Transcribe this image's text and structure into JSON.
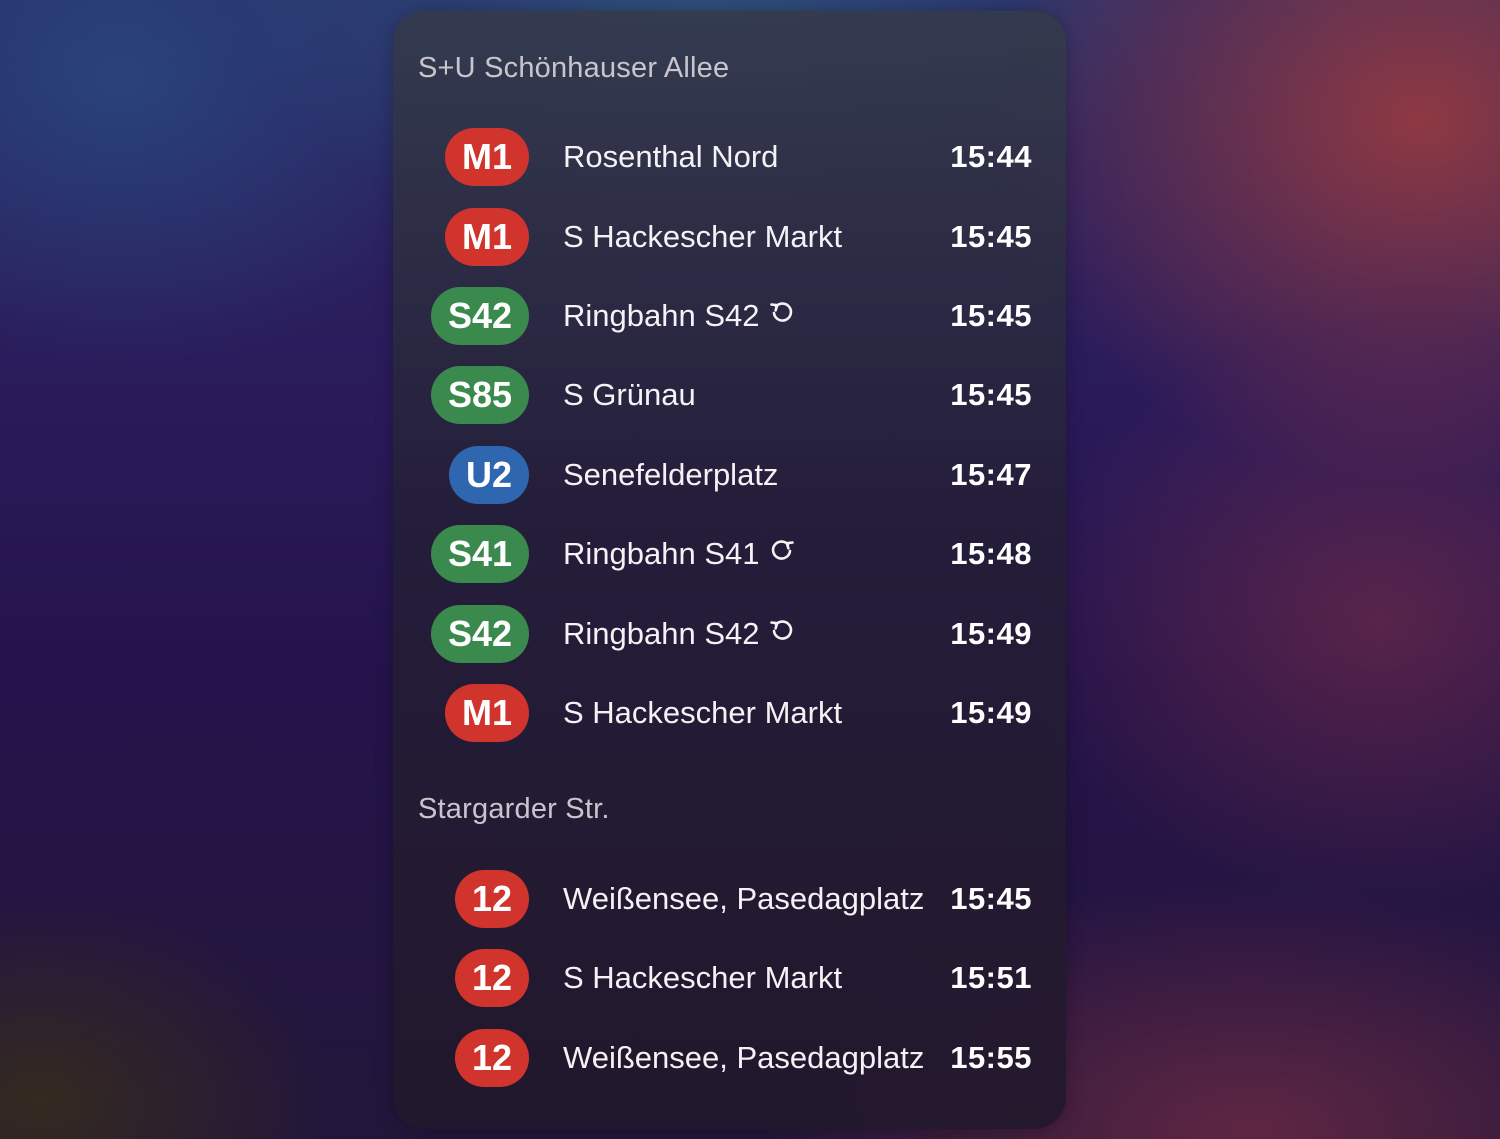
{
  "stations": [
    {
      "name": "S+U Schönhauser Allee",
      "departures": [
        {
          "line": "M1",
          "color": "red",
          "destination": "Rosenthal Nord",
          "icon": "",
          "time": "15:44"
        },
        {
          "line": "M1",
          "color": "red",
          "destination": "S Hackescher Markt",
          "icon": "",
          "time": "15:45"
        },
        {
          "line": "S42",
          "color": "green",
          "destination": "Ringbahn S42",
          "icon": "ring-counterclockwise-icon",
          "time": "15:45"
        },
        {
          "line": "S85",
          "color": "green",
          "destination": "S Grünau",
          "icon": "",
          "time": "15:45"
        },
        {
          "line": "U2",
          "color": "blue",
          "destination": "Senefelderplatz",
          "icon": "",
          "time": "15:47"
        },
        {
          "line": "S41",
          "color": "green",
          "destination": "Ringbahn S41",
          "icon": "ring-clockwise-icon",
          "time": "15:48"
        },
        {
          "line": "S42",
          "color": "green",
          "destination": "Ringbahn S42",
          "icon": "ring-counterclockwise-icon",
          "time": "15:49"
        },
        {
          "line": "M1",
          "color": "red",
          "destination": "S Hackescher Markt",
          "icon": "",
          "time": "15:49"
        }
      ]
    },
    {
      "name": "Stargarder Str.",
      "departures": [
        {
          "line": "12",
          "color": "red",
          "destination": "Weißensee, Pasedagplatz",
          "icon": "",
          "time": "15:45"
        },
        {
          "line": "12",
          "color": "red",
          "destination": "S Hackescher Markt",
          "icon": "",
          "time": "15:51"
        },
        {
          "line": "12",
          "color": "red",
          "destination": "Weißensee, Pasedagplatz",
          "icon": "",
          "time": "15:55"
        }
      ]
    }
  ],
  "colors": {
    "red": "#d0342c",
    "green": "#3a8a4e",
    "blue": "#2f66b0"
  }
}
